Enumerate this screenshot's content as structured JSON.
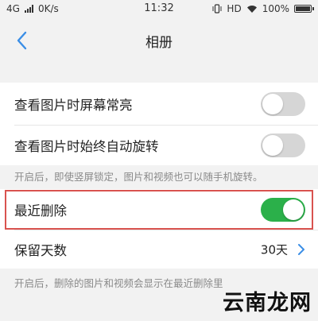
{
  "status_bar": {
    "network": "4G",
    "speed": "0K/s",
    "time": "11:32",
    "hd": "HD",
    "battery": "100%"
  },
  "header": {
    "title": "相册"
  },
  "settings": {
    "screen_on": {
      "label": "查看图片时屏幕常亮",
      "enabled": false
    },
    "auto_rotate": {
      "label": "查看图片时始终自动旋转",
      "enabled": false
    },
    "rotate_hint": "开启后，即使竖屏锁定，图片和视频也可以随手机旋转。",
    "recently_deleted": {
      "label": "最近删除",
      "enabled": true
    },
    "keep_days": {
      "label": "保留天数",
      "value": "30天"
    },
    "deleted_hint": "开启后，删除的图片和视频会显示在最近删除里"
  },
  "colors": {
    "toggle_on": "#2bb04a",
    "toggle_off": "#d6d6d6",
    "accent_blue": "#3a8ee6",
    "highlight_border": "#d9534f"
  },
  "watermark": "云南龙网"
}
